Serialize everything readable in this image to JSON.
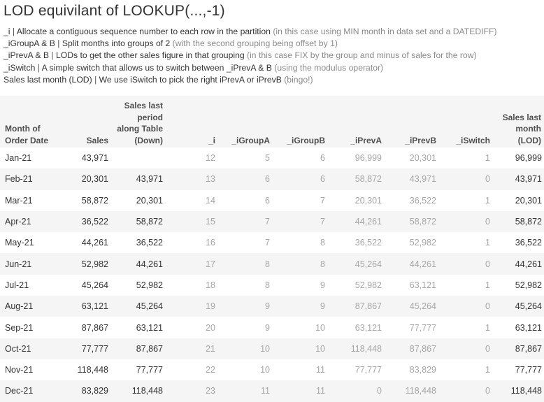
{
  "title": "LOD equivilant of LOOKUP(...,-1)",
  "notes": [
    {
      "key": "_i",
      "main": "Allocate a contiguous sequence number to each row in the partition",
      "paren": "(in this case using MIN month in data set and a DATEDIFF)"
    },
    {
      "key": "_iGroupA & B",
      "main": "Split months into groups of 2",
      "paren": "(with the second grouping being offset by 1)"
    },
    {
      "key": "_iPrevA & B",
      "main": "LODs to get the other sales figure in that grouping",
      "paren": "(in this case FIX by the group and minus of sales for the row)"
    },
    {
      "key": "_iSwitch",
      "main": "A simple switch that allows us to switch between _iPrevA & B",
      "paren": "(using the modulus operator)"
    },
    {
      "key": "Sales last month (LOD)",
      "main": "We use iSwitch to pick the right iPrevA or iPrevB",
      "paren": "(bingo!)"
    }
  ],
  "separator": "|",
  "headers": {
    "month": [
      "Month of",
      "Order Date"
    ],
    "sales": [
      "Sales"
    ],
    "sales_last_period": [
      "Sales last",
      "period",
      "along Table",
      "(Down)"
    ],
    "i": [
      "_i"
    ],
    "igroupa": [
      "_iGroupA"
    ],
    "igroupb": [
      "_iGroupB"
    ],
    "iprevb_a": [
      "_iPrevA"
    ],
    "iprevb": [
      "_iPrevB"
    ],
    "iswitch": [
      "_iSwitch"
    ],
    "sales_last_month": [
      "Sales last",
      "month",
      "(LOD)"
    ]
  },
  "rows": [
    {
      "month": "Jan-21",
      "sales": "43,971",
      "slp": "",
      "i": "12",
      "ga": "5",
      "gb": "6",
      "pa": "96,999",
      "pb": "20,301",
      "sw": "1",
      "slm": "96,999"
    },
    {
      "month": "Feb-21",
      "sales": "20,301",
      "slp": "43,971",
      "i": "13",
      "ga": "6",
      "gb": "6",
      "pa": "58,872",
      "pb": "43,971",
      "sw": "0",
      "slm": "43,971"
    },
    {
      "month": "Mar-21",
      "sales": "58,872",
      "slp": "20,301",
      "i": "14",
      "ga": "6",
      "gb": "7",
      "pa": "20,301",
      "pb": "36,522",
      "sw": "1",
      "slm": "20,301"
    },
    {
      "month": "Apr-21",
      "sales": "36,522",
      "slp": "58,872",
      "i": "15",
      "ga": "7",
      "gb": "7",
      "pa": "44,261",
      "pb": "58,872",
      "sw": "0",
      "slm": "58,872"
    },
    {
      "month": "May-21",
      "sales": "44,261",
      "slp": "36,522",
      "i": "16",
      "ga": "7",
      "gb": "8",
      "pa": "36,522",
      "pb": "52,982",
      "sw": "1",
      "slm": "36,522"
    },
    {
      "month": "Jun-21",
      "sales": "52,982",
      "slp": "44,261",
      "i": "17",
      "ga": "8",
      "gb": "8",
      "pa": "45,264",
      "pb": "44,261",
      "sw": "0",
      "slm": "44,261"
    },
    {
      "month": "Jul-21",
      "sales": "45,264",
      "slp": "52,982",
      "i": "18",
      "ga": "8",
      "gb": "9",
      "pa": "52,982",
      "pb": "63,121",
      "sw": "1",
      "slm": "52,982"
    },
    {
      "month": "Aug-21",
      "sales": "63,121",
      "slp": "45,264",
      "i": "19",
      "ga": "9",
      "gb": "9",
      "pa": "87,867",
      "pb": "45,264",
      "sw": "0",
      "slm": "45,264"
    },
    {
      "month": "Sep-21",
      "sales": "87,867",
      "slp": "63,121",
      "i": "20",
      "ga": "9",
      "gb": "10",
      "pa": "63,121",
      "pb": "77,777",
      "sw": "1",
      "slm": "63,121"
    },
    {
      "month": "Oct-21",
      "sales": "77,777",
      "slp": "87,867",
      "i": "21",
      "ga": "10",
      "gb": "10",
      "pa": "118,448",
      "pb": "87,867",
      "sw": "0",
      "slm": "87,867"
    },
    {
      "month": "Nov-21",
      "sales": "118,448",
      "slp": "77,777",
      "i": "22",
      "ga": "10",
      "gb": "11",
      "pa": "77,777",
      "pb": "83,829",
      "sw": "1",
      "slm": "77,777"
    },
    {
      "month": "Dec-21",
      "sales": "83,829",
      "slp": "118,448",
      "i": "23",
      "ga": "11",
      "gb": "11",
      "pa": "0",
      "pb": "118,448",
      "sw": "0",
      "slm": "118,448"
    }
  ],
  "colors": {
    "stripe": "#f5f5f5",
    "dim_text": "#a6a6a6",
    "text": "#333333",
    "header_text": "#4f4f4f"
  }
}
